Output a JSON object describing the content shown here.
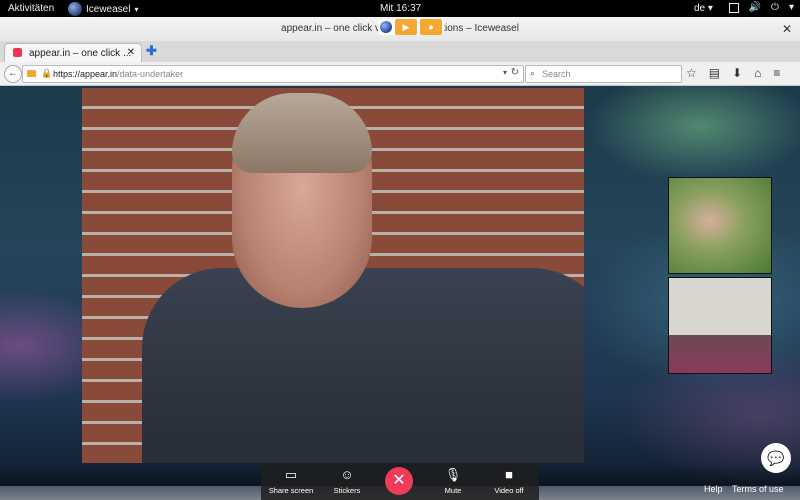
{
  "topbar": {
    "activities": "Aktivitäten",
    "app_name": "Iceweasel",
    "clock": "Mit 16:37",
    "lang": "de",
    "lang_caret": "▾"
  },
  "window": {
    "title": "appear.in – one click video conversations – Iceweasel"
  },
  "tab": {
    "label": "appear.in – one click ...",
    "close": "✕",
    "new_tab": "✚"
  },
  "nav": {
    "back": "←",
    "url_host": "https://appear.in",
    "url_path": "/data-undertaker",
    "search_placeholder": "Search",
    "menu": "≡"
  },
  "controls": {
    "share_screen": "Share screen",
    "stickers": "Stickers",
    "end_call": "✕",
    "mute": "Mute",
    "video_off": "Video off"
  },
  "footer": {
    "help": "Help",
    "terms": "Terms of use"
  },
  "colors": {
    "accent": "#f4a732",
    "end_call": "#f23b5b"
  }
}
